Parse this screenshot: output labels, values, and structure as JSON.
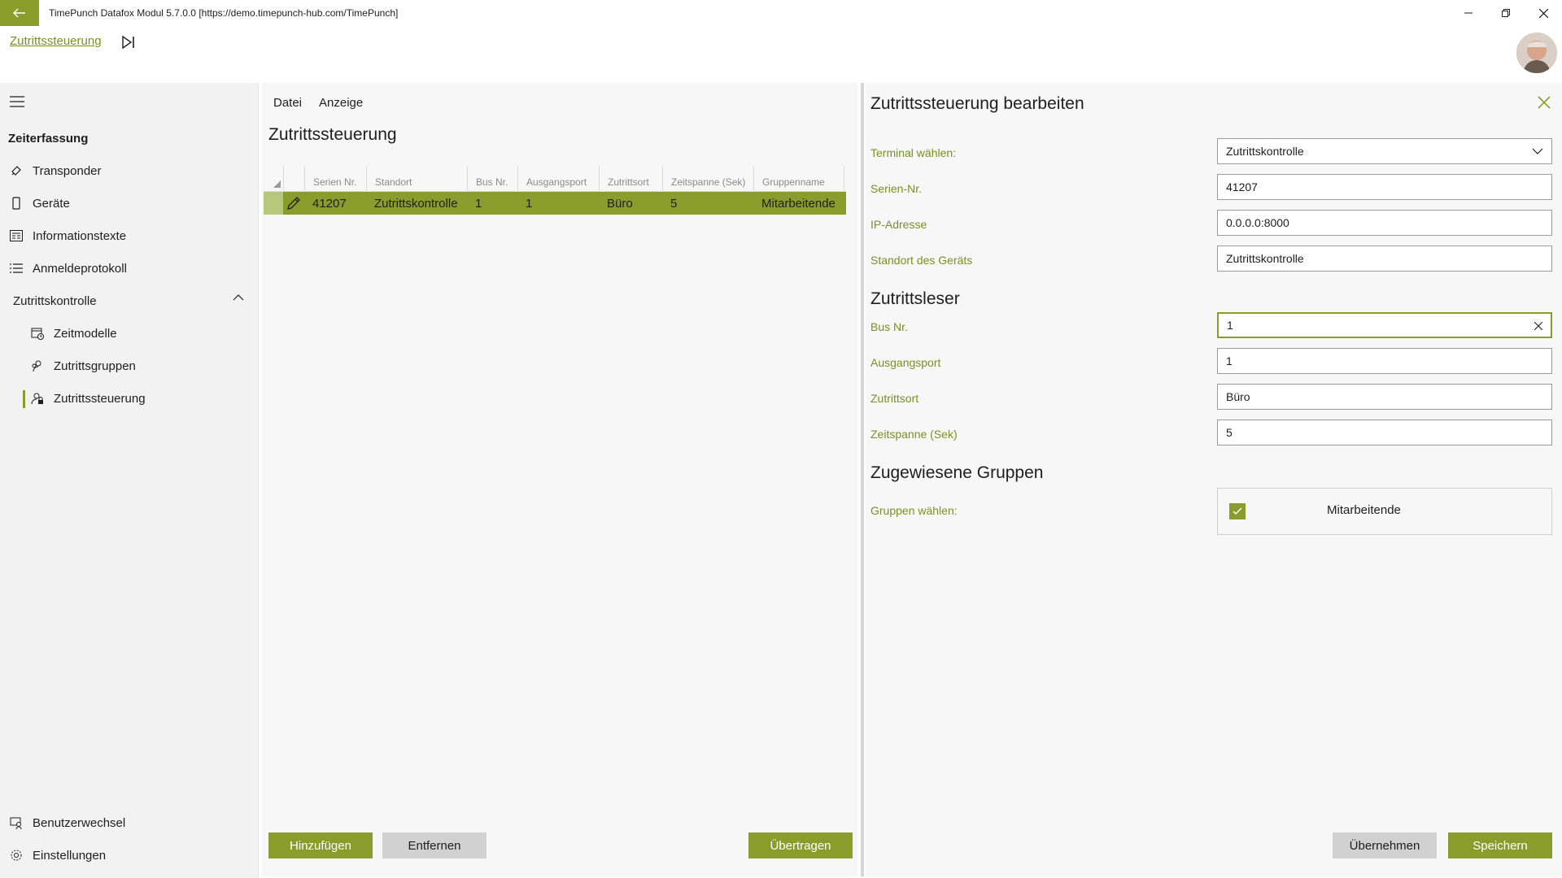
{
  "window": {
    "title": "TimePunch Datafox Modul 5.7.0.0 [https://demo.timepunch-hub.com/TimePunch]"
  },
  "header": {
    "breadcrumb": "Zutrittssteuerung"
  },
  "sidebar": {
    "section_title": "Zeiterfassung",
    "items": [
      {
        "label": "Transponder",
        "icon": "transponder-icon"
      },
      {
        "label": "Geräte",
        "icon": "device-icon"
      },
      {
        "label": "Informationstexte",
        "icon": "info-text-icon"
      },
      {
        "label": "Anmeldeprotokoll",
        "icon": "list-icon"
      },
      {
        "label": "Zutrittskontrolle",
        "icon": "",
        "expanded": true
      },
      {
        "label": "Zeitmodelle",
        "icon": "calendar-clock-icon"
      },
      {
        "label": "Zutrittsgruppen",
        "icon": "people-icon"
      },
      {
        "label": "Zutrittssteuerung",
        "icon": "lock-person-icon",
        "selected": true
      }
    ],
    "bottom": [
      {
        "label": "Benutzerwechsel",
        "icon": "switch-user-icon"
      },
      {
        "label": "Einstellungen",
        "icon": "gear-icon"
      }
    ]
  },
  "middle": {
    "menu": [
      "Datei",
      "Anzeige"
    ],
    "title": "Zutrittssteuerung",
    "columns": [
      "Serien Nr.",
      "Standort",
      "Bus Nr.",
      "Ausgangsport",
      "Zutrittsort",
      "Zeitspanne (Sek)",
      "Gruppenname"
    ],
    "rows": [
      [
        "41207",
        "Zutrittskontrolle",
        "1",
        "1",
        "Büro",
        "5",
        "Mitarbeitende"
      ]
    ],
    "buttons": {
      "add": "Hinzufügen",
      "remove": "Entfernen",
      "transfer": "Übertragen"
    }
  },
  "editor": {
    "title": "Zutrittssteuerung bearbeiten",
    "terminal_label": "Terminal wählen:",
    "terminal_value": "Zutrittskontrolle",
    "serial_label": "Serien-Nr.",
    "serial_value": "41207",
    "ip_label": "IP-Adresse",
    "ip_value": "0.0.0.0:8000",
    "location_label": "Standort des Geräts",
    "location_value": "Zutrittskontrolle",
    "reader_title": "Zutrittsleser",
    "bus_label": "Bus Nr.",
    "bus_value": "1",
    "port_label": "Ausgangsport",
    "port_value": "1",
    "place_label": "Zutrittsort",
    "place_value": "Büro",
    "time_label": "Zeitspanne (Sek)",
    "time_value": "5",
    "groups_title": "Zugewiesene Gruppen",
    "groups_label": "Gruppen wählen:",
    "group_name": "Mitarbeitende",
    "group_checked": true,
    "apply": "Übernehmen",
    "save": "Speichern"
  },
  "colors": {
    "accent": "#8a9d2c",
    "label": "#7a8f1f"
  }
}
